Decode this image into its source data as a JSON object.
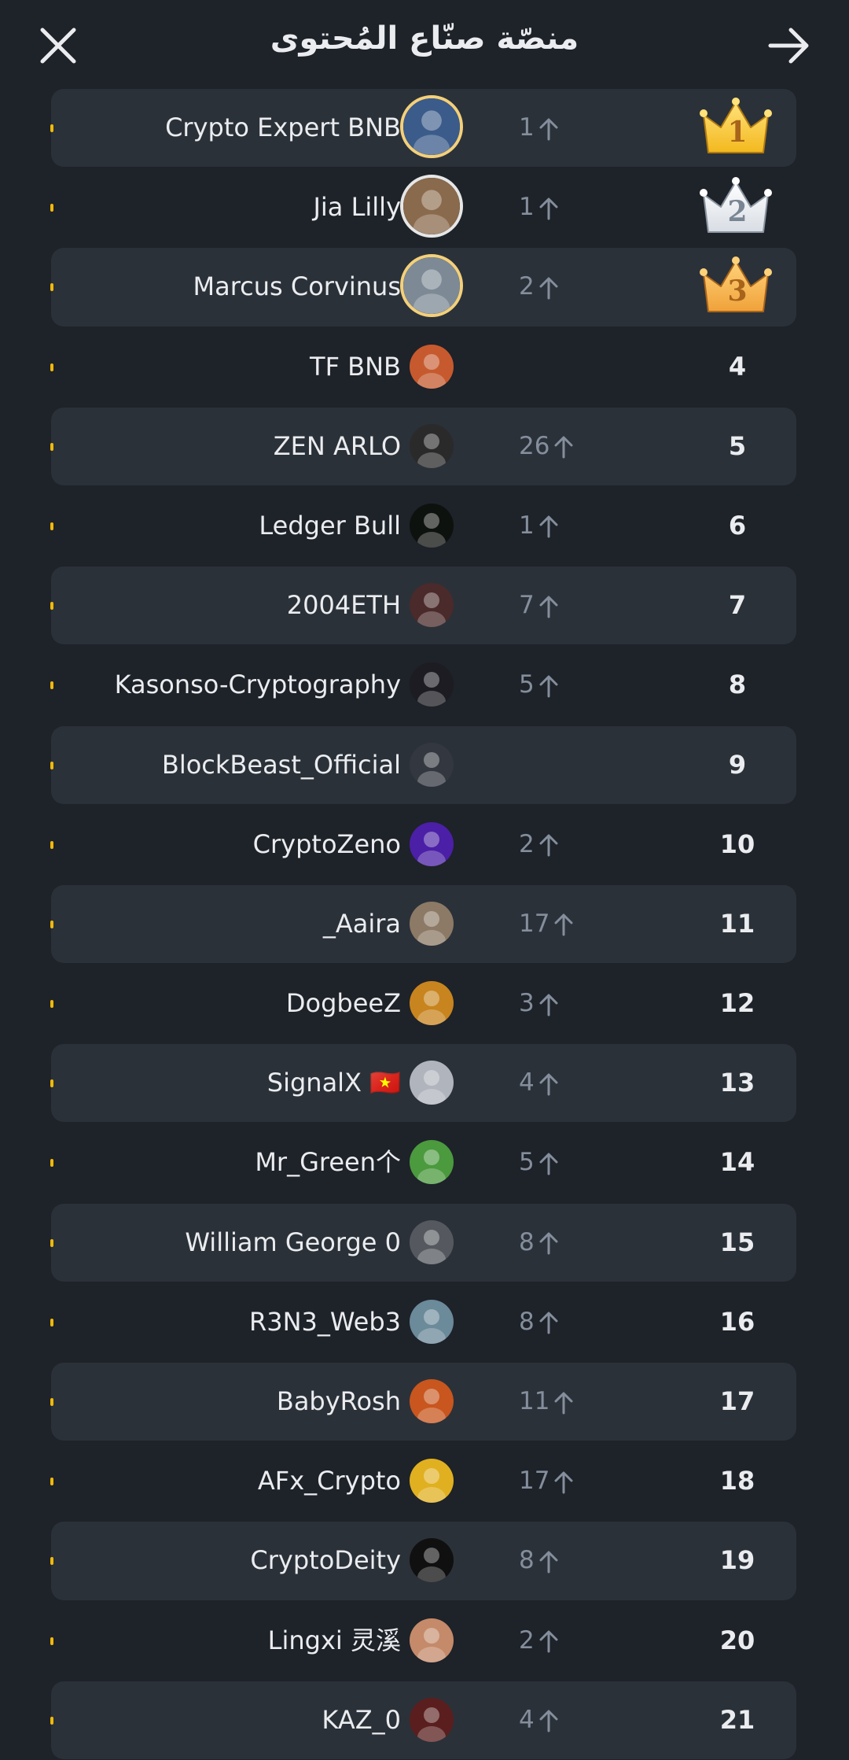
{
  "header": {
    "title": "منصّة صنّاع المُحتوى",
    "close_icon": "close-icon",
    "next_icon": "arrow-right-icon"
  },
  "colors": {
    "background": "#1e2229",
    "row_alt": "#2b3139",
    "accent": "#f0b90b",
    "muted": "#848e9c"
  },
  "rows": [
    {
      "name": "Crypto Expert BNB",
      "change": "1",
      "rank": "1",
      "crown": "gold"
    },
    {
      "name": "Jia Lilly",
      "change": "1",
      "rank": "2",
      "crown": "silver"
    },
    {
      "name": "Marcus Corvinus",
      "change": "2",
      "rank": "3",
      "crown": "bronze"
    },
    {
      "name": "TF BNB",
      "change": "",
      "rank": "4"
    },
    {
      "name": "ZEN ARLO",
      "change": "26",
      "rank": "5"
    },
    {
      "name": "Ledger Bull",
      "change": "1",
      "rank": "6"
    },
    {
      "name": "2004ETH",
      "change": "7",
      "rank": "7"
    },
    {
      "name": "Kasonso-Cryptography",
      "change": "5",
      "rank": "8"
    },
    {
      "name": "BlockBeast_Official",
      "change": "",
      "rank": "9"
    },
    {
      "name": "CryptoZeno",
      "change": "2",
      "rank": "10"
    },
    {
      "name": "_Aaira",
      "change": "17",
      "rank": "11"
    },
    {
      "name": "DogbeeZ",
      "change": "3",
      "rank": "12"
    },
    {
      "name": "SignalX 🇻🇳",
      "change": "4",
      "rank": "13"
    },
    {
      "name": "Mr_Green个",
      "change": "5",
      "rank": "14"
    },
    {
      "name": "William George 0",
      "change": "8",
      "rank": "15"
    },
    {
      "name": "R3N3_Web3",
      "change": "8",
      "rank": "16"
    },
    {
      "name": "BabyRosh",
      "change": "11",
      "rank": "17"
    },
    {
      "name": "AFx_Crypto",
      "change": "17",
      "rank": "18"
    },
    {
      "name": "CryptoDeity",
      "change": "8",
      "rank": "19"
    },
    {
      "name": "Lingxi 灵溪",
      "change": "2",
      "rank": "20"
    },
    {
      "name": "KAZ_0",
      "change": "4",
      "rank": "21"
    }
  ]
}
